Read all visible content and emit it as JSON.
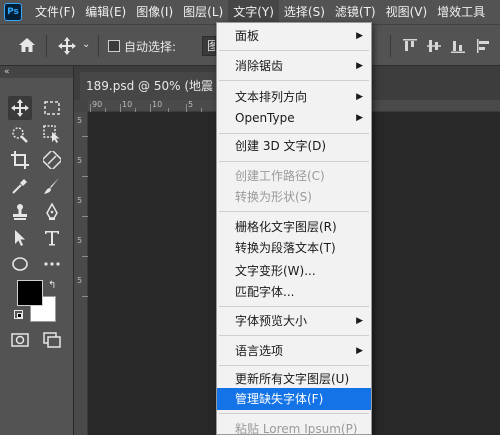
{
  "app": {
    "logo": "Ps"
  },
  "menubar": {
    "items": [
      "文件(F)",
      "编辑(E)",
      "图像(I)",
      "图层(L)",
      "文字(Y)",
      "选择(S)",
      "滤镜(T)",
      "视图(V)",
      "增效工具"
    ]
  },
  "options": {
    "home_icon": "home-icon",
    "move_icon": "move-icon",
    "auto_select_label": "自动选择:",
    "auto_select_value": "图"
  },
  "tabs": {
    "collapse": "«",
    "doc_title": "189.psd @ 50% (地震 自"
  },
  "rulers": {
    "top_labels": [
      "90",
      "10",
      "10",
      "5"
    ],
    "left_labels": [
      "5",
      "5",
      "5",
      "5",
      "5"
    ]
  },
  "menu": {
    "items": [
      {
        "label": "面板",
        "submenu": true,
        "disabled": false
      },
      {
        "label": "消除锯齿",
        "submenu": true,
        "disabled": false
      },
      {
        "label": "文本排列方向",
        "submenu": true,
        "disabled": false
      },
      {
        "label": "OpenType",
        "submenu": true,
        "disabled": false
      },
      {
        "label": "创建 3D 文字(D)",
        "submenu": false,
        "disabled": false
      },
      {
        "label": "创建工作路径(C)",
        "submenu": false,
        "disabled": true
      },
      {
        "label": "转换为形状(S)",
        "submenu": false,
        "disabled": true
      },
      {
        "label": "栅格化文字图层(R)",
        "submenu": false,
        "disabled": false
      },
      {
        "label": "转换为段落文本(T)",
        "submenu": false,
        "disabled": false
      },
      {
        "label": "文字变形(W)...",
        "submenu": false,
        "disabled": false
      },
      {
        "label": "匹配字体...",
        "submenu": false,
        "disabled": false
      },
      {
        "label": "字体预览大小",
        "submenu": true,
        "disabled": false
      },
      {
        "label": "语言选项",
        "submenu": true,
        "disabled": false
      },
      {
        "label": "更新所有文字图层(U)",
        "submenu": false,
        "disabled": false
      },
      {
        "label": "管理缺失字体(F)",
        "submenu": false,
        "disabled": false,
        "highlighted": true
      },
      {
        "label": "粘贴 Lorem Ipsum(P)",
        "submenu": false,
        "disabled": true
      }
    ],
    "submenu_arrow": "▶"
  },
  "colors": {
    "highlight": "#1473e6",
    "foreground_swatch": "#000000",
    "background_swatch": "#ffffff"
  }
}
